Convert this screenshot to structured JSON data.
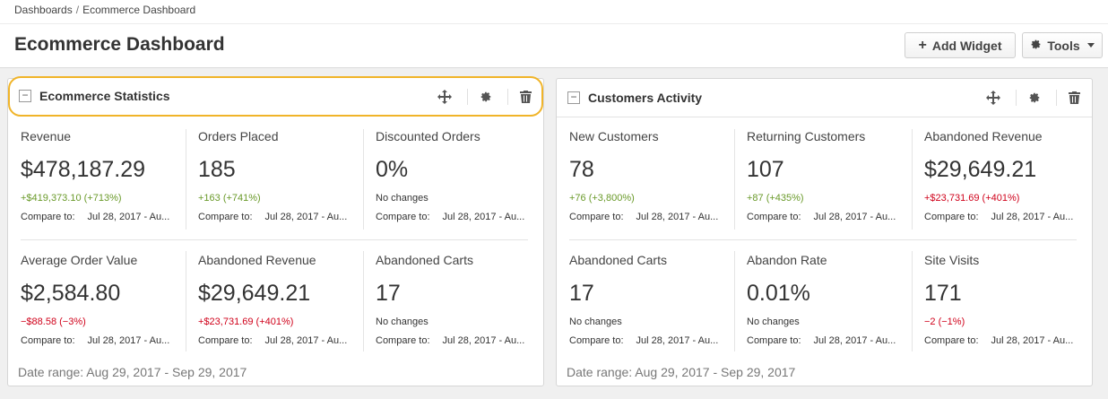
{
  "breadcrumb": {
    "root": "Dashboards",
    "sep": "/",
    "current": "Ecommerce Dashboard"
  },
  "page": {
    "title": "Ecommerce Dashboard"
  },
  "toolbar": {
    "add_widget_label": "Add Widget",
    "tools_label": "Tools"
  },
  "icons": {
    "add": "plus-icon",
    "tools": "gear-icon",
    "move": "move-icon",
    "settings": "gear-icon",
    "delete": "trash-icon"
  },
  "colors": {
    "positive": "#6a9a2a",
    "negative": "#d0021b",
    "focus_ring": "#f0b429"
  },
  "widgets": [
    {
      "title": "Ecommerce Statistics",
      "collapse_glyph": "−",
      "date_range": "Date range: Aug 29, 2017 - Sep 29, 2017",
      "metrics": [
        {
          "name": "Revenue",
          "value": "$478,187.29",
          "change": "+$419,373.10 (+713%)",
          "trend": "pos",
          "compare_label": "Compare to:",
          "compare_date": "Jul 28, 2017 - Au..."
        },
        {
          "name": "Orders Placed",
          "value": "185",
          "change": "+163 (+741%)",
          "trend": "pos",
          "compare_label": "Compare to:",
          "compare_date": "Jul 28, 2017 - Au..."
        },
        {
          "name": "Discounted Orders",
          "value": "0%",
          "change": "No changes",
          "trend": "neu",
          "compare_label": "Compare to:",
          "compare_date": "Jul 28, 2017 - Au..."
        },
        {
          "name": "Average Order Value",
          "value": "$2,584.80",
          "change": "−$88.58 (−3%)",
          "trend": "neg",
          "compare_label": "Compare to:",
          "compare_date": "Jul 28, 2017 - Au..."
        },
        {
          "name": "Abandoned Revenue",
          "value": "$29,649.21",
          "change": "+$23,731.69 (+401%)",
          "trend": "neg",
          "compare_label": "Compare to:",
          "compare_date": "Jul 28, 2017 - Au..."
        },
        {
          "name": "Abandoned Carts",
          "value": "17",
          "change": "No changes",
          "trend": "neu",
          "compare_label": "Compare to:",
          "compare_date": "Jul 28, 2017 - Au..."
        }
      ]
    },
    {
      "title": "Customers Activity",
      "collapse_glyph": "−",
      "date_range": "Date range: Aug 29, 2017 - Sep 29, 2017",
      "metrics": [
        {
          "name": "New Customers",
          "value": "78",
          "change": "+76 (+3,800%)",
          "trend": "pos",
          "compare_label": "Compare to:",
          "compare_date": "Jul 28, 2017 - Au..."
        },
        {
          "name": "Returning Customers",
          "value": "107",
          "change": "+87 (+435%)",
          "trend": "pos",
          "compare_label": "Compare to:",
          "compare_date": "Jul 28, 2017 - Au..."
        },
        {
          "name": "Abandoned Revenue",
          "value": "$29,649.21",
          "change": "+$23,731.69 (+401%)",
          "trend": "neg",
          "compare_label": "Compare to:",
          "compare_date": "Jul 28, 2017 - Au..."
        },
        {
          "name": "Abandoned Carts",
          "value": "17",
          "change": "No changes",
          "trend": "neu",
          "compare_label": "Compare to:",
          "compare_date": "Jul 28, 2017 - Au..."
        },
        {
          "name": "Abandon Rate",
          "value": "0.01%",
          "change": "No changes",
          "trend": "neu",
          "compare_label": "Compare to:",
          "compare_date": "Jul 28, 2017 - Au..."
        },
        {
          "name": "Site Visits",
          "value": "171",
          "change": "−2 (−1%)",
          "trend": "neg",
          "compare_label": "Compare to:",
          "compare_date": "Jul 28, 2017 - Au..."
        }
      ]
    }
  ]
}
